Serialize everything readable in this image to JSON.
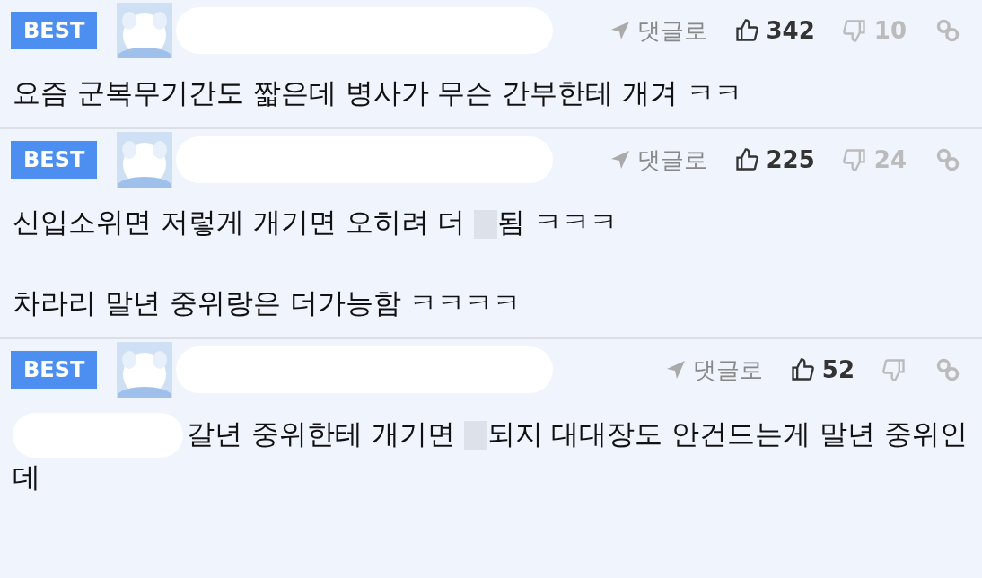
{
  "comments": [
    {
      "badge": "BEST",
      "reply": "댓글로",
      "likes": "342",
      "dislikes": "10",
      "paragraphs": [
        [
          {
            "kind": "text",
            "text": "요즘 군복무기간도 짧은데 병사가 무슨 간부한테 개겨 ㅋㅋ"
          }
        ]
      ]
    },
    {
      "badge": "BEST",
      "reply": "댓글로",
      "likes": "225",
      "dislikes": "24",
      "paragraphs": [
        [
          {
            "kind": "text",
            "text": "신입소위면 저렇게 개기면 오히려 더 "
          },
          {
            "kind": "redacted"
          },
          {
            "kind": "text",
            "text": "됨 ㅋㅋㅋ"
          }
        ],
        [
          {
            "kind": "text",
            "text": "차라리 말년 중위랑은 더가능함 ㅋㅋㅋㅋ"
          }
        ]
      ]
    },
    {
      "badge": "BEST",
      "reply": "댓글로",
      "likes": "52",
      "paragraphs": [
        [
          {
            "kind": "blob"
          },
          {
            "kind": "text",
            "text": "갈년 중위한테 개기면 "
          },
          {
            "kind": "redacted"
          },
          {
            "kind": "text",
            "text": "되지 대대장도 안건드는게 말년 중위인데"
          }
        ]
      ]
    }
  ]
}
